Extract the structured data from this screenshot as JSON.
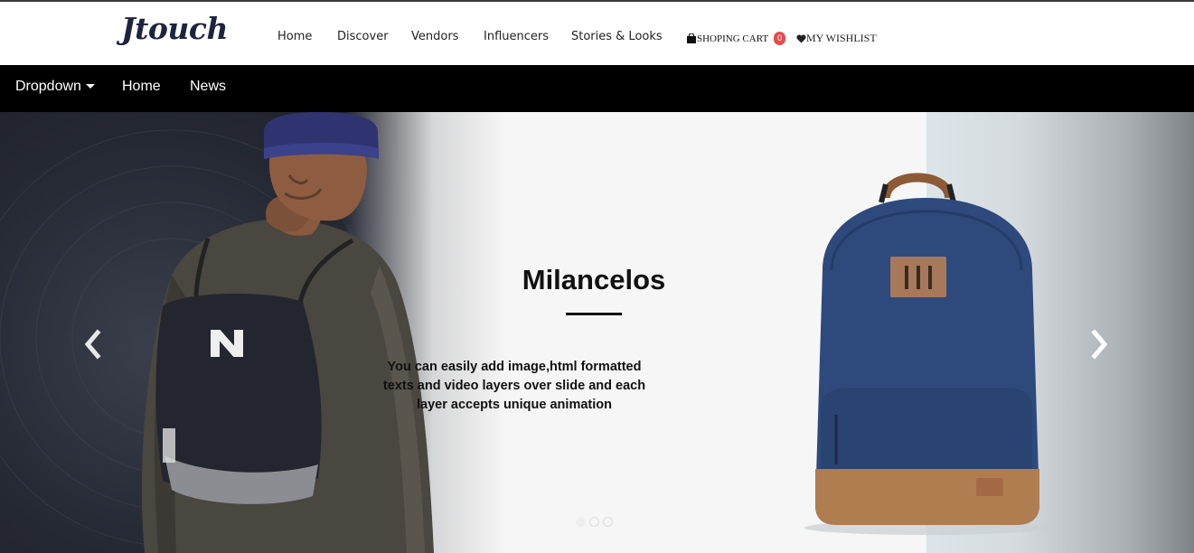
{
  "brand": {
    "logo_text": "Jtouch"
  },
  "topnav": {
    "links": [
      {
        "label": "Home"
      },
      {
        "label": "Discover"
      },
      {
        "label": "Vendors"
      },
      {
        "label": "Influencers"
      },
      {
        "label": "Stories & Looks"
      }
    ],
    "cart": {
      "label": "SHOPING CART",
      "count": "0",
      "icon": "shopping-bag-icon"
    },
    "wishlist": {
      "label": "MY WISHLIST",
      "icon": "heart-icon"
    }
  },
  "menubar": {
    "dropdown_label": "Dropdown",
    "home_label": "Home",
    "news_label": "News"
  },
  "slider": {
    "title": "Milancelos",
    "text": "You can easily add image,html formatted texts and video layers over slide and each layer accepts unique animation",
    "prev_icon": "chevron-left-icon",
    "next_icon": "chevron-right-icon",
    "slide_count": 3,
    "active_slide": 1
  },
  "colors": {
    "header_bg": "#ffffff",
    "menubar_bg": "#000000",
    "badge": "#e74c4c",
    "logo": "#1c2440"
  }
}
